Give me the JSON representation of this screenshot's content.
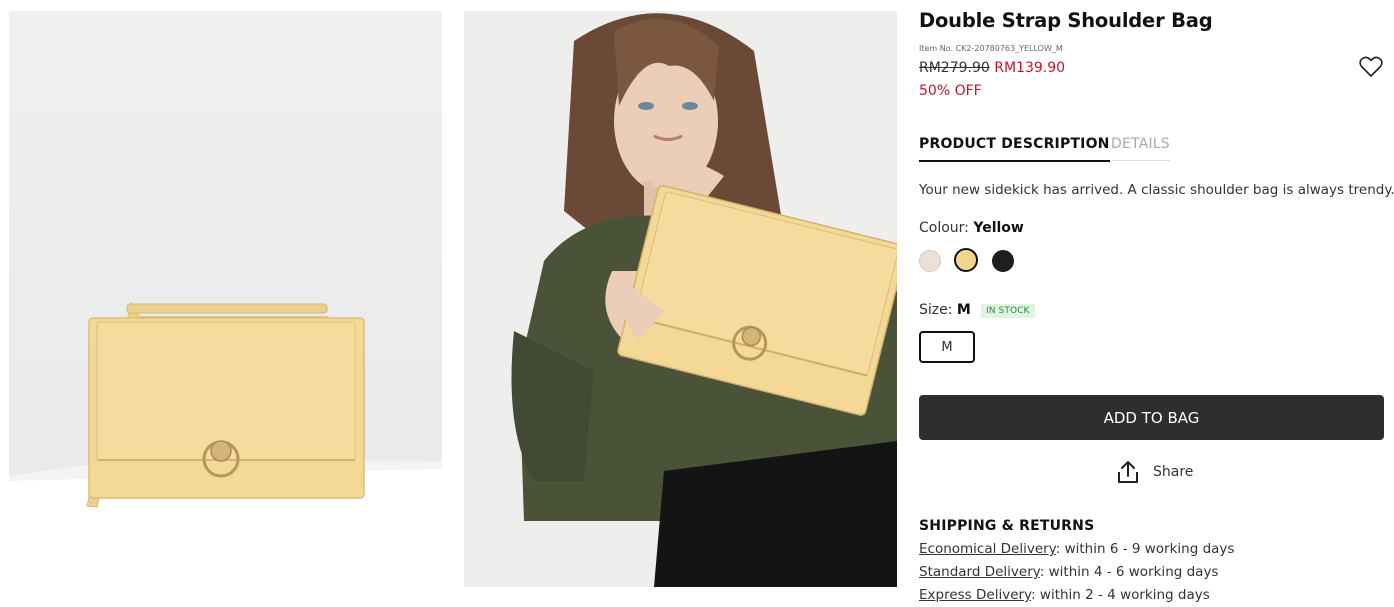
{
  "product": {
    "title": "Double Strap Shoulder Bag",
    "item_no": "Item No. CK2-20780763_YELLOW_M",
    "price_original": "RM279.90",
    "price_sale": "RM139.90",
    "discount": "50% OFF",
    "wishlist_icon": "heart-outline-icon"
  },
  "images": [
    {
      "name": "product-image-flatlay"
    },
    {
      "name": "product-image-model"
    }
  ],
  "tabs": [
    {
      "label": "PRODUCT DESCRIPTION",
      "active": true
    },
    {
      "label": "DETAILS",
      "active": false
    }
  ],
  "description": "Your new sidekick has arrived. A classic shoulder bag is always trendy.",
  "colour": {
    "label": "Colour:",
    "selected": "Yellow",
    "swatches": [
      {
        "color": "#efe0d6"
      },
      {
        "color": "#f2d48c",
        "selected": true
      },
      {
        "color": "#1e1e1e"
      }
    ]
  },
  "size": {
    "label": "Size:",
    "selected": "M",
    "stock_badge": "IN STOCK",
    "options": [
      "M"
    ]
  },
  "actions": {
    "add_to_bag": "ADD TO BAG",
    "share": "Share",
    "share_icon": "share-upload-icon"
  },
  "shipping": {
    "heading": "SHIPPING & RETURNS",
    "options": [
      {
        "label": "Economical Delivery",
        "detail": ": within 6 - 9 working days"
      },
      {
        "label": "Standard Delivery",
        "detail": ": within 4 - 6 working days"
      },
      {
        "label": "Express Delivery",
        "detail": ": within 2 - 4 working days"
      }
    ]
  },
  "colors": {
    "sale": "#d0102a",
    "button": "#2e2e2e",
    "stock_green": "#2f8a3a",
    "bag_yellow": "#f2d48c"
  }
}
